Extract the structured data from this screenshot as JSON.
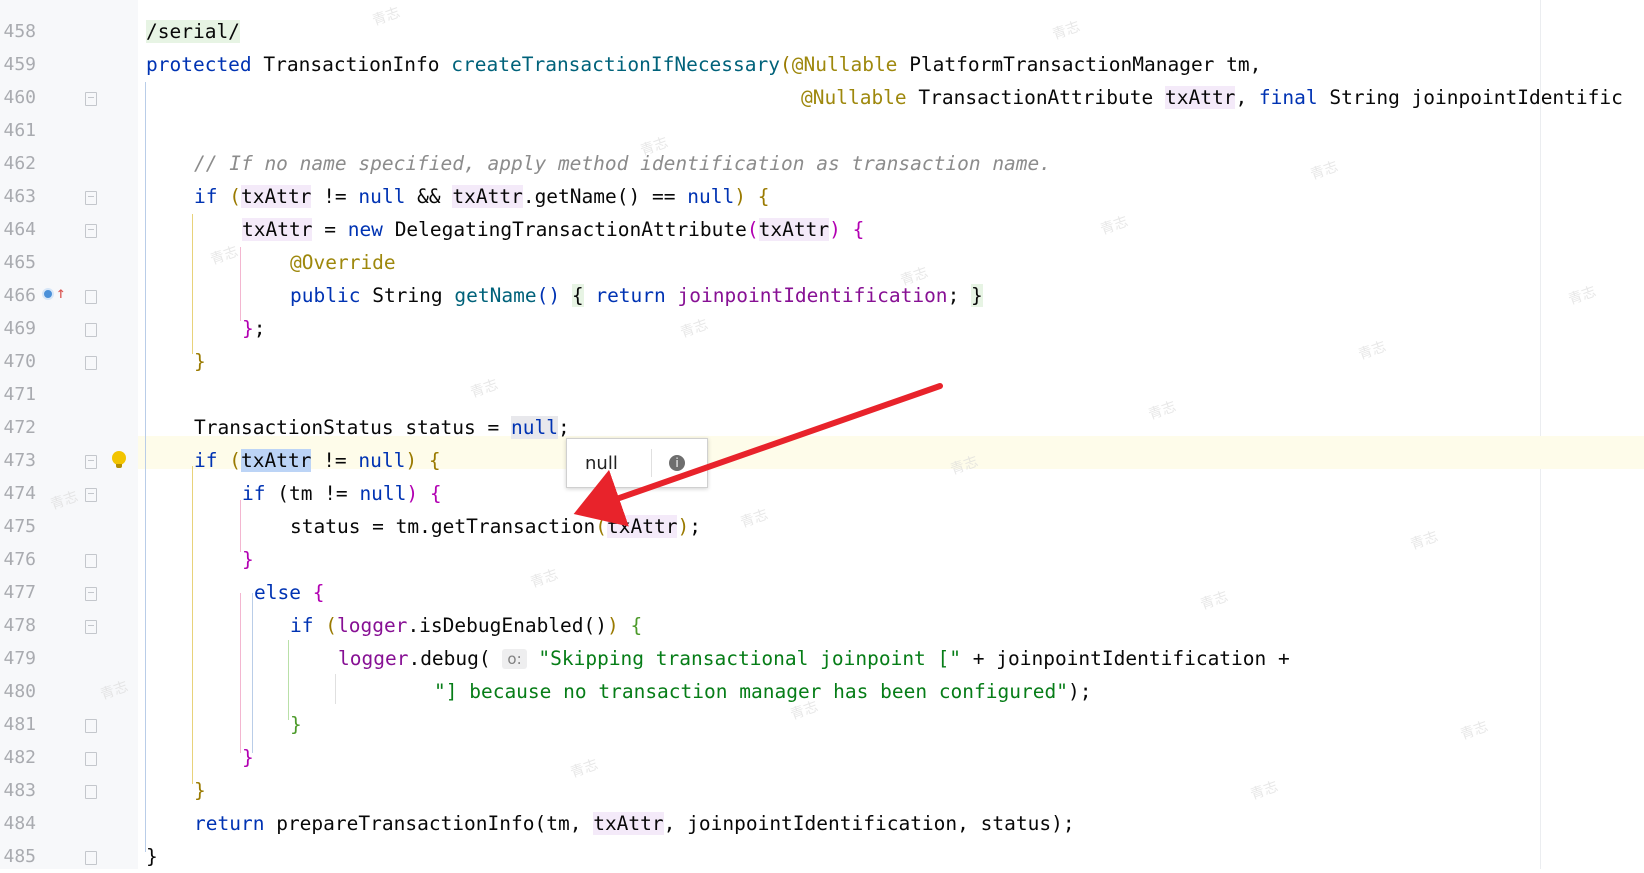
{
  "editor": {
    "line_numbers": [
      "458",
      "459",
      "460",
      "461",
      "462",
      "463",
      "464",
      "465",
      "466",
      "469",
      "470",
      "471",
      "472",
      "473",
      "474",
      "475",
      "476",
      "477",
      "478",
      "479",
      "480",
      "481",
      "482",
      "483",
      "484",
      "485"
    ],
    "code_lines": {
      "l458": "/serial/",
      "l459_kw": "protected",
      "l459_type": "TransactionInfo",
      "l459_fn": "createTransactionIfNecessary",
      "l459_ann": "@Nullable",
      "l459_param": "PlatformTransactionManager tm,",
      "l460_ann": "@Nullable",
      "l460_type": "TransactionAttribute",
      "l460_var": "txAttr",
      "l460_kw": "final",
      "l460_rest": "String joinpointIdentific",
      "l462_comment": "// If no name specified, apply method identification as transaction name.",
      "l463_kw": "if",
      "l463_var1": "txAttr",
      "l463_op1": "!=",
      "l463_null1": "null",
      "l463_and": "&&",
      "l463_var2": "txAttr",
      "l463_call": ".getName()",
      "l463_op2": "==",
      "l463_null2": "null",
      "l464_var": "txAttr",
      "l464_eq": "=",
      "l464_kw": "new",
      "l464_type": "DelegatingTransactionAttribute",
      "l464_arg": "txAttr",
      "l465_ann": "@Override",
      "l466_kw": "public",
      "l466_type": "String",
      "l466_fn": "getName",
      "l466_kw2": "return",
      "l466_fld": "joinpointIdentification",
      "l469": "};",
      "l470": "}",
      "l472_type": "TransactionStatus status =",
      "l472_null": "null",
      "l473_kw": "if",
      "l473_var": "txAttr",
      "l473_op": "!=",
      "l473_null": "null",
      "l474_kw": "if",
      "l474_rest": "(tm !=",
      "l474_null": "null",
      "l475_a": "status = tm.getTransaction",
      "l475_arg": "txAttr",
      "l476": "}",
      "l477_kw": "else",
      "l478_kw": "if",
      "l478_fld": "logger",
      "l478_call": ".isDebugEnabled()",
      "l479_fld": "logger",
      "l479_call": ".debug(",
      "l479_hint": "o:",
      "l479_str": "\"Skipping transactional joinpoint [\"",
      "l479_rest": "+ joinpointIdentification +",
      "l480_str": "\"] because no transaction manager has been configured\"",
      "l481": "}",
      "l482": "}",
      "l483": "}",
      "l484_kw": "return",
      "l484_call": "prepareTransactionInfo(tm,",
      "l484_var": "txAttr",
      "l484_rest": ", joinpointIdentification, status);",
      "l485": "}"
    }
  },
  "debug_tooltip": {
    "value": "null",
    "icon": "info-icon"
  },
  "annotation": {
    "arrow_color": "#e8232b"
  },
  "watermark_text": "青志"
}
